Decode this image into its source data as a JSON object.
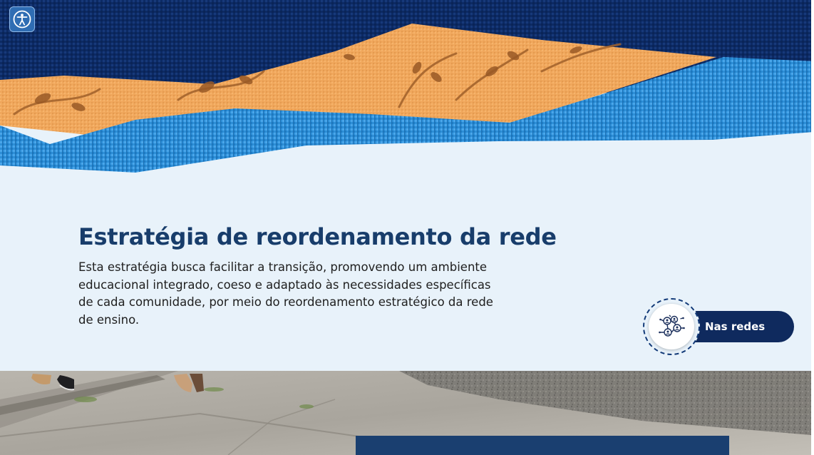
{
  "accessibility": {
    "icon": "accessibility-icon",
    "color": "#2f6db3"
  },
  "hero": {
    "title": "Estratégia de reordenamento da rede",
    "description": "Esta estratégia busca facilitar a transição, promovendo um ambiente educacional integrado, coeso e adaptado às necessidades específicas de cada comunidade, por meio do reordenamento estratégico da rede de ensino."
  },
  "social": {
    "label": "Nas redes",
    "icon": "network-people-icon",
    "color": "#0f2a5e"
  },
  "colors": {
    "title": "#183d6b",
    "background": "#e8f2fa",
    "navy_fabric": "#0c2a64",
    "blue_fabric": "#2d8fd8",
    "orange_fabric": "#f0a75c"
  }
}
